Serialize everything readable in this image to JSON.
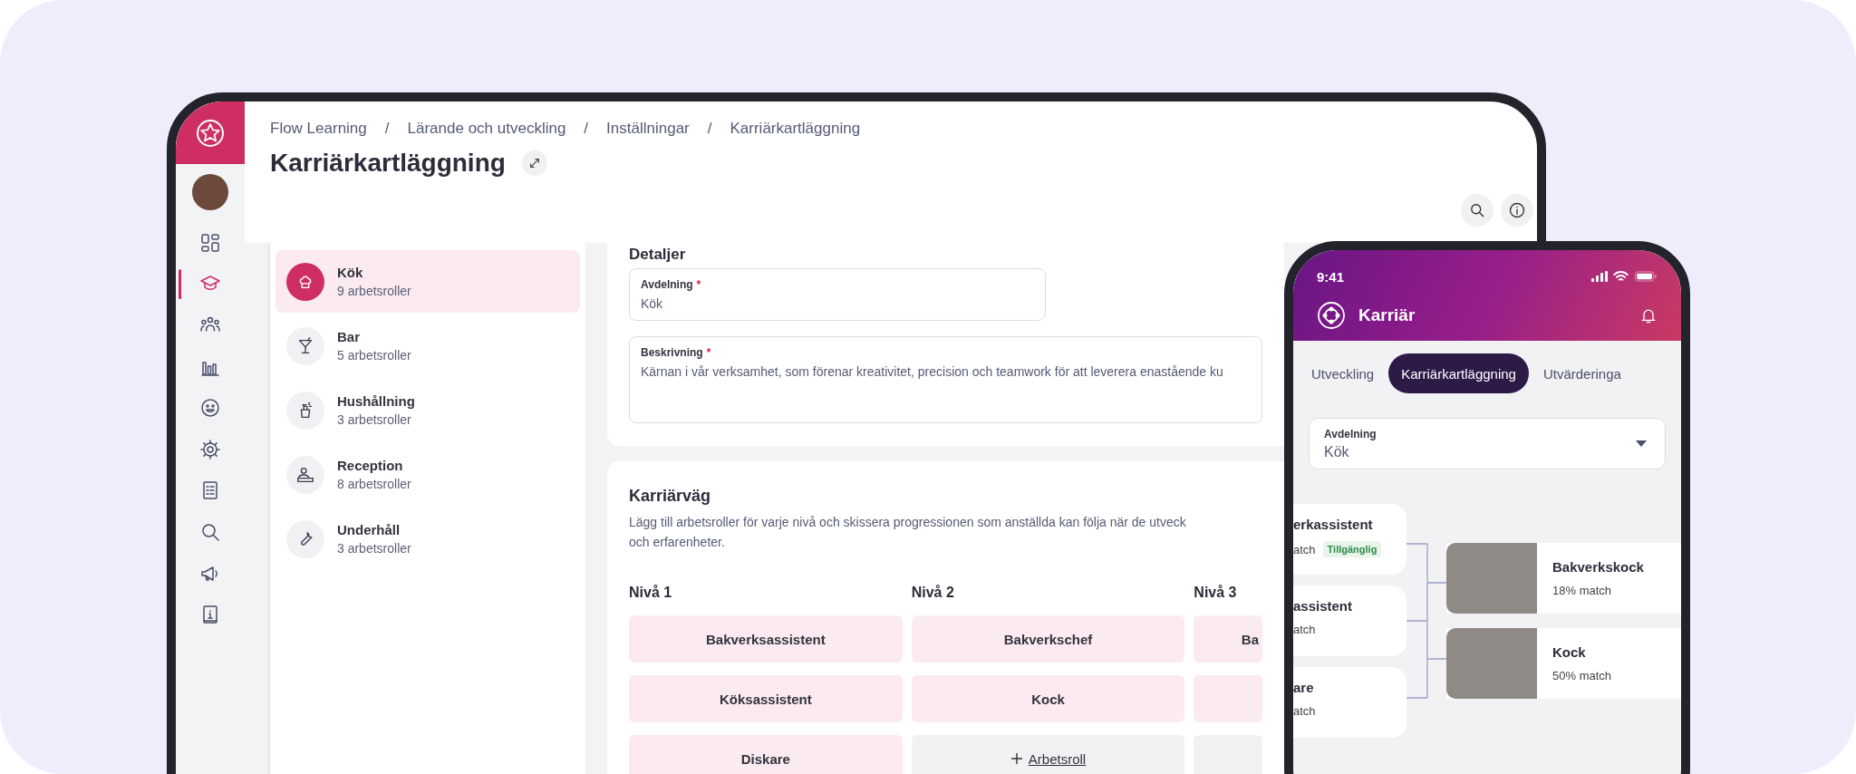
{
  "tablet": {
    "sidebar": {
      "nav": [
        {
          "kind": "dashboard",
          "selected": false
        },
        {
          "kind": "learning",
          "selected": true
        },
        {
          "kind": "people",
          "selected": false
        },
        {
          "kind": "stats",
          "selected": false
        },
        {
          "kind": "mood",
          "selected": false
        },
        {
          "kind": "settings",
          "selected": false
        },
        {
          "kind": "documents",
          "selected": false
        },
        {
          "kind": "search",
          "selected": false
        },
        {
          "kind": "announcements",
          "selected": false
        },
        {
          "kind": "guide",
          "selected": false
        }
      ]
    },
    "breadcrumbs": [
      "Flow Learning",
      "Lärande och utveckling",
      "Inställningar",
      "Karriärkartläggning"
    ],
    "breadcrumb_separator": "/",
    "title": "Karriärkartläggning",
    "departments": [
      {
        "name": "Kök",
        "count": "9 arbetsroller",
        "kind": "kitchen",
        "selected": true
      },
      {
        "name": "Bar",
        "count": "5 arbetsroller",
        "kind": "bar",
        "selected": false
      },
      {
        "name": "Hushållning",
        "count": "3 arbetsroller",
        "kind": "housekeeping",
        "selected": false
      },
      {
        "name": "Reception",
        "count": "8 arbetsroller",
        "kind": "reception",
        "selected": false
      },
      {
        "name": "Underhåll",
        "count": "3 arbetsroller",
        "kind": "maintenance",
        "selected": false
      }
    ],
    "details": {
      "title": "Detaljer",
      "fields": [
        {
          "label": "Avdelning",
          "required_mark": "*",
          "value": "Kök",
          "kind": "short"
        },
        {
          "label": "Beskrivning",
          "required_mark": "*",
          "value": "Kärnan i vår verksamhet, som förenar kreativitet, precision och teamwork för att leverera enastående ku",
          "kind": "long"
        }
      ]
    },
    "career_path": {
      "title": "Karriärväg",
      "description_lines": [
        "Lägg till arbetsroller för varje nivå och skissera progressionen som anställda kan följa när de utveck",
        "och erfarenheter."
      ],
      "levels": [
        {
          "label": "Nivå 1",
          "roles": [
            {
              "kind": "role",
              "name": "Bakverksassistent"
            },
            {
              "kind": "role",
              "name": "Köksassistent"
            },
            {
              "kind": "role",
              "name": "Diskare"
            }
          ]
        },
        {
          "label": "Nivå 2",
          "roles": [
            {
              "kind": "role",
              "name": "Bakverkschef"
            },
            {
              "kind": "role",
              "name": "Kock"
            },
            {
              "kind": "add",
              "name": "Arbetsroll"
            }
          ]
        },
        {
          "label": "Nivå 3",
          "roles": [
            {
              "kind": "role",
              "name": "Ba"
            },
            {
              "kind": "role"
            },
            {
              "kind": "empty"
            }
          ]
        }
      ]
    }
  },
  "phone": {
    "status_time": "9:41",
    "title": "Karriär",
    "tabs": [
      {
        "label": "Utveckling",
        "selected": false
      },
      {
        "label": "Karriärkartläggning",
        "selected": true
      },
      {
        "label": "Utvärderinga",
        "selected": false
      }
    ],
    "department_select": {
      "label": "Avdelning",
      "value": "Kök"
    },
    "path_from": [
      {
        "name": "erkassistent",
        "match": "atch",
        "badge": "Tillgänglig"
      },
      {
        "name": "assistent",
        "match": "atch"
      },
      {
        "name": "are",
        "match": "atch"
      }
    ],
    "path_to": [
      {
        "name": "Bakverkskock",
        "match": "18% match"
      },
      {
        "name": "Kock",
        "match": "50% match"
      }
    ]
  }
}
